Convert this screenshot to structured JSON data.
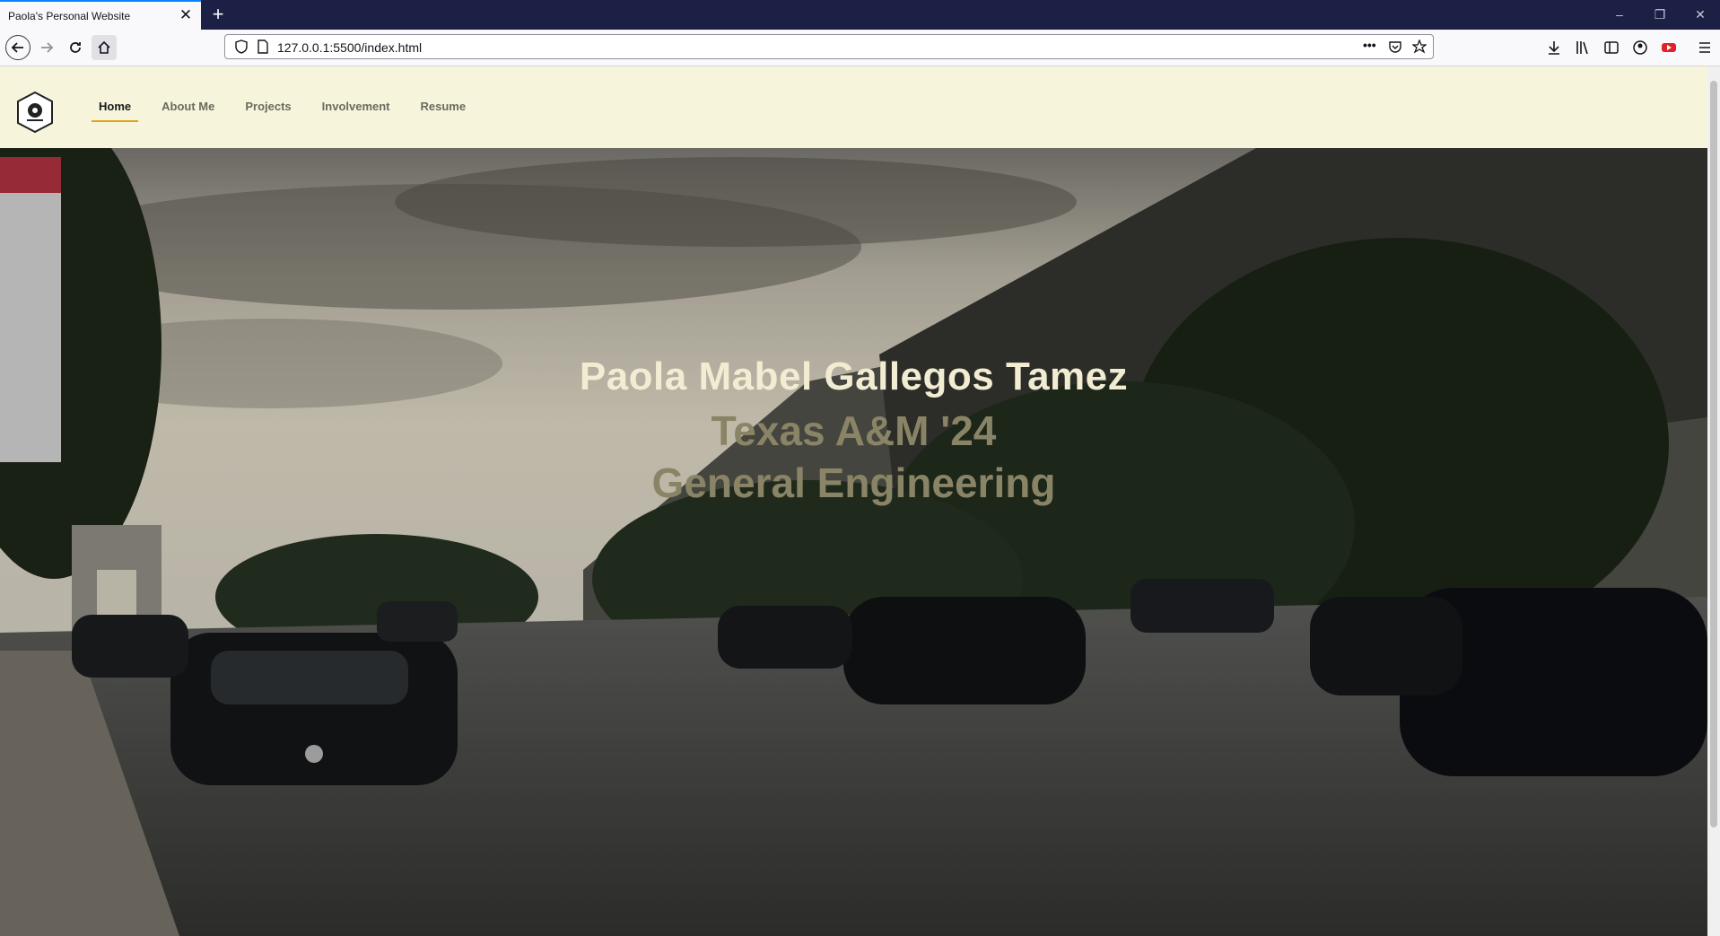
{
  "browser": {
    "tab_title": "Paola's Personal Website",
    "tab_close": "✕",
    "new_tab": "+",
    "url": "127.0.0.1:5500/index.html",
    "page_actions": "•••",
    "window_controls": {
      "minimize": "–",
      "restore": "❐",
      "close": "✕"
    }
  },
  "site_nav": {
    "items": [
      {
        "label": "Home",
        "active": true
      },
      {
        "label": "About Me",
        "active": false
      },
      {
        "label": "Projects",
        "active": false
      },
      {
        "label": "Involvement",
        "active": false
      },
      {
        "label": "Resume",
        "active": false
      }
    ]
  },
  "hero": {
    "name": "Paola Mabel Gallegos Tamez",
    "line1": "Texas A&M '24",
    "line2": "General Engineering"
  },
  "colors": {
    "header_bg": "#f6f5dc",
    "nav_active_underline": "#e3a21a",
    "hero_name": "#f1ecd2",
    "hero_sub": "#8a8466",
    "tabbar_bg": "#1c2045"
  }
}
